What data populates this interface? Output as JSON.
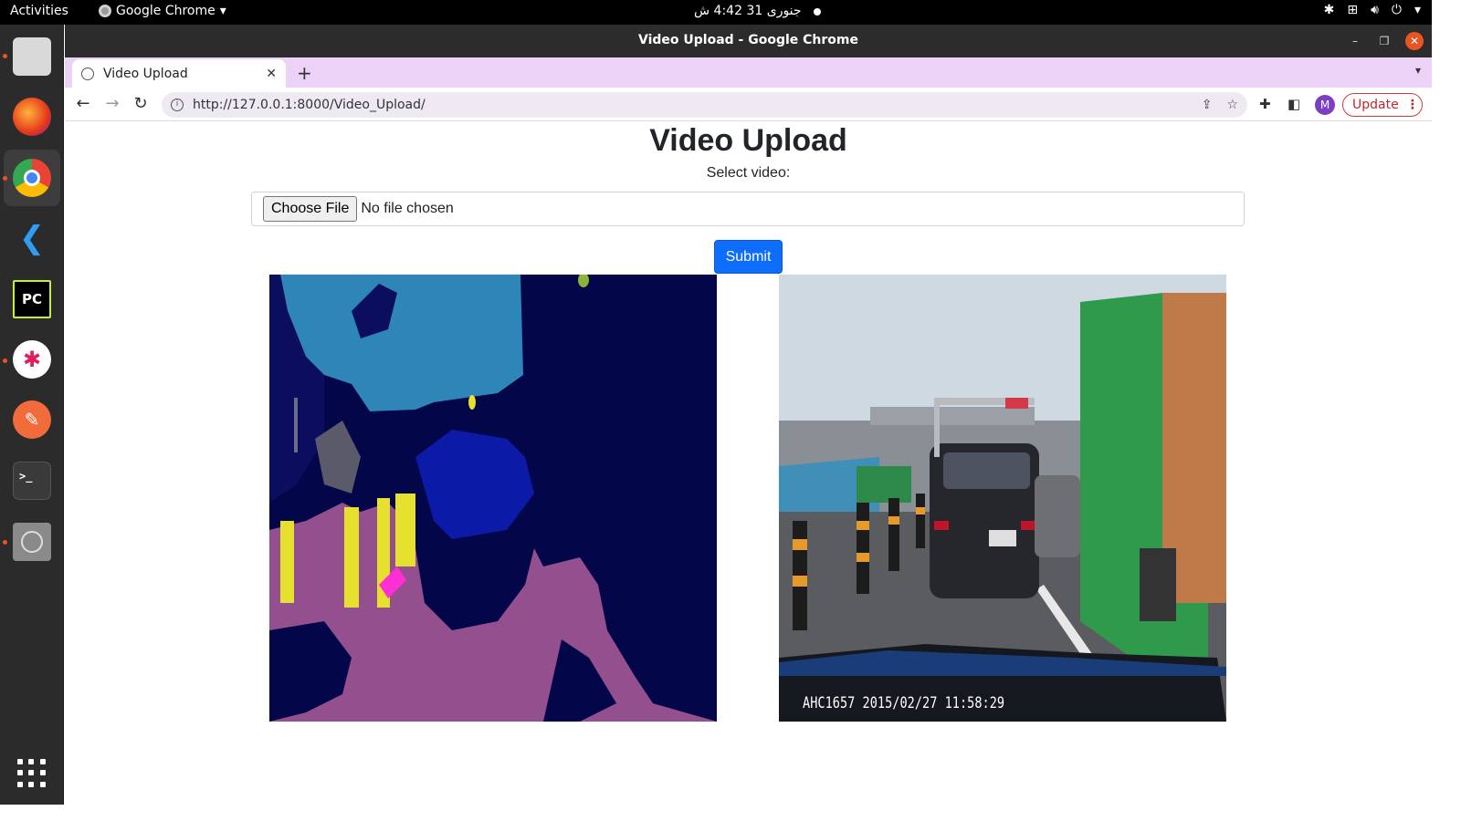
{
  "topbar": {
    "activities": "Activities",
    "app_name": "Google Chrome",
    "clock": "جنوری 31  4:42 ش"
  },
  "dock": {
    "items": [
      "files",
      "firefox",
      "chrome",
      "vscode",
      "pycharm",
      "slack",
      "postman",
      "terminal",
      "disc"
    ]
  },
  "window": {
    "title": "Video Upload - Google Chrome"
  },
  "browser": {
    "tab_title": "Video Upload",
    "url": "http://127.0.0.1:8000/Video_Upload/",
    "profile_initial": "M",
    "update_label": "Update"
  },
  "page": {
    "heading": "Video Upload",
    "select_label": "Select video:",
    "choose_file_label": "Choose File",
    "file_status": "No file chosen",
    "submit_label": "Submit",
    "camera_timestamp": "AHC1657  2015/02/27 11:58:29"
  },
  "colors": {
    "tab_strip": "#ecd2f7",
    "submit_blue": "#0d6efd",
    "update_red": "#d23b3b",
    "ubuntu_orange": "#e95420"
  }
}
